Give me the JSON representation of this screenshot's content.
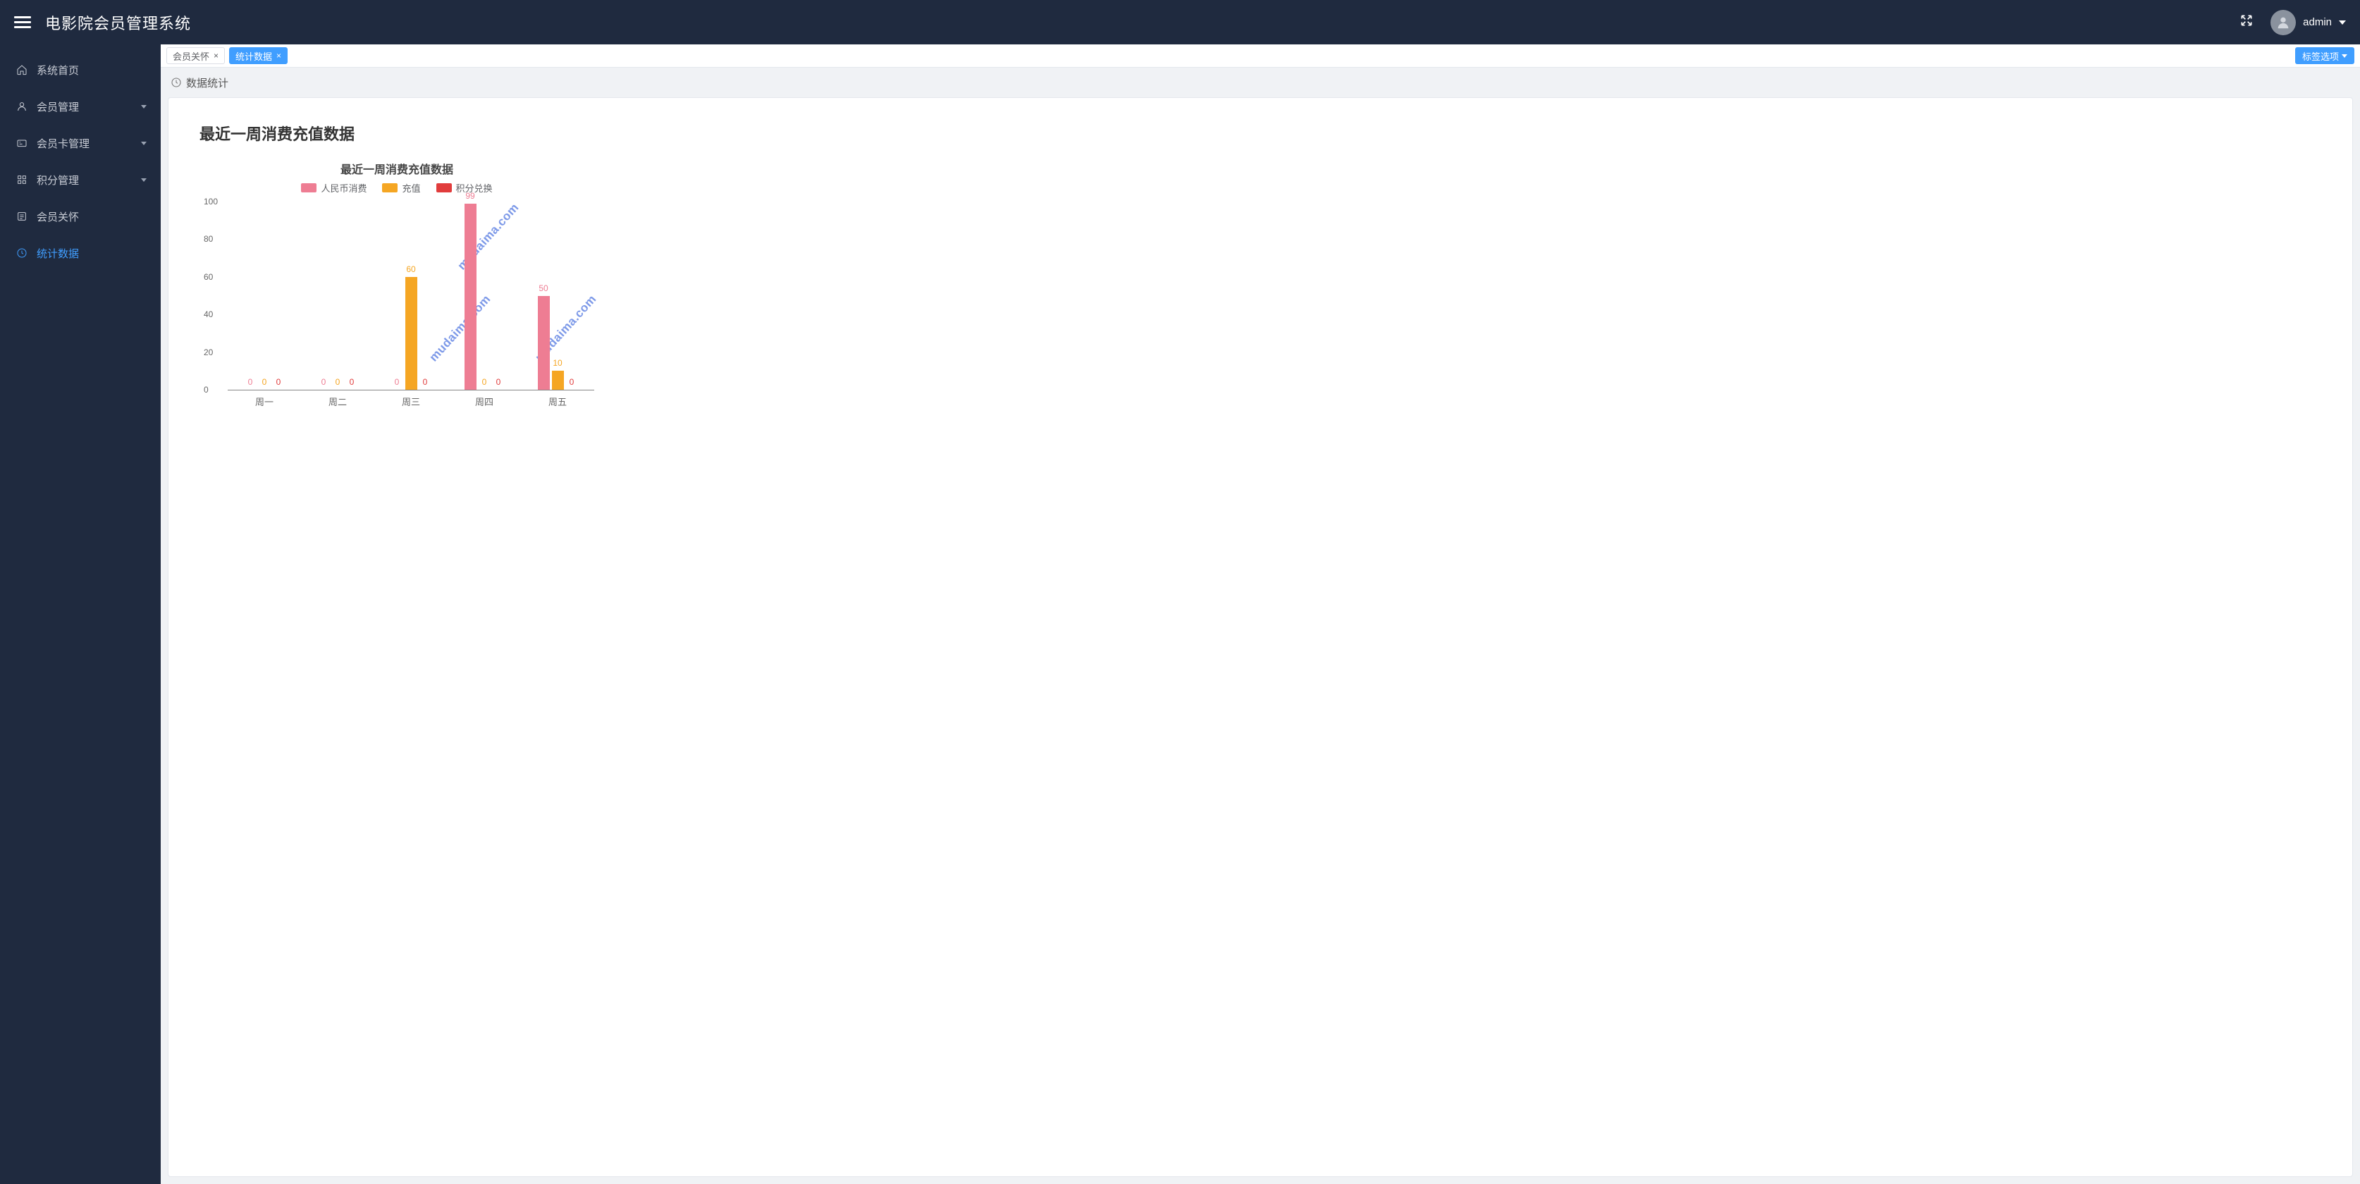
{
  "header": {
    "title": "电影院会员管理系统",
    "username": "admin"
  },
  "sidebar": {
    "items": [
      {
        "label": "系统首页",
        "expandable": false
      },
      {
        "label": "会员管理",
        "expandable": true
      },
      {
        "label": "会员卡管理",
        "expandable": true
      },
      {
        "label": "积分管理",
        "expandable": true
      },
      {
        "label": "会员关怀",
        "expandable": false
      },
      {
        "label": "统计数据",
        "expandable": false
      }
    ],
    "active_index": 5
  },
  "tabs": {
    "items": [
      {
        "label": "会员关怀",
        "active": false
      },
      {
        "label": "统计数据",
        "active": true
      }
    ],
    "options_label": "标签选项"
  },
  "panel": {
    "title": "数据统计"
  },
  "section": {
    "title": "最近一周消费充值数据"
  },
  "watermark": "mudaima.com",
  "colors": {
    "s0": "#ee7d93",
    "s1": "#f5a623",
    "s2": "#e13c3c"
  },
  "chart_data": {
    "type": "bar",
    "title": "最近一周消费充值数据",
    "xlabel": "",
    "ylabel": "",
    "ylim": [
      0,
      100
    ],
    "yticks": [
      0,
      20,
      40,
      60,
      80,
      100
    ],
    "categories": [
      "周一",
      "周二",
      "周三",
      "周四",
      "周五"
    ],
    "series": [
      {
        "name": "人民币消费",
        "values": [
          0,
          0,
          0,
          99,
          50
        ]
      },
      {
        "name": "充值",
        "values": [
          0,
          0,
          60,
          0,
          10
        ]
      },
      {
        "name": "积分兑换",
        "values": [
          0,
          0,
          0,
          0,
          0
        ]
      }
    ]
  }
}
